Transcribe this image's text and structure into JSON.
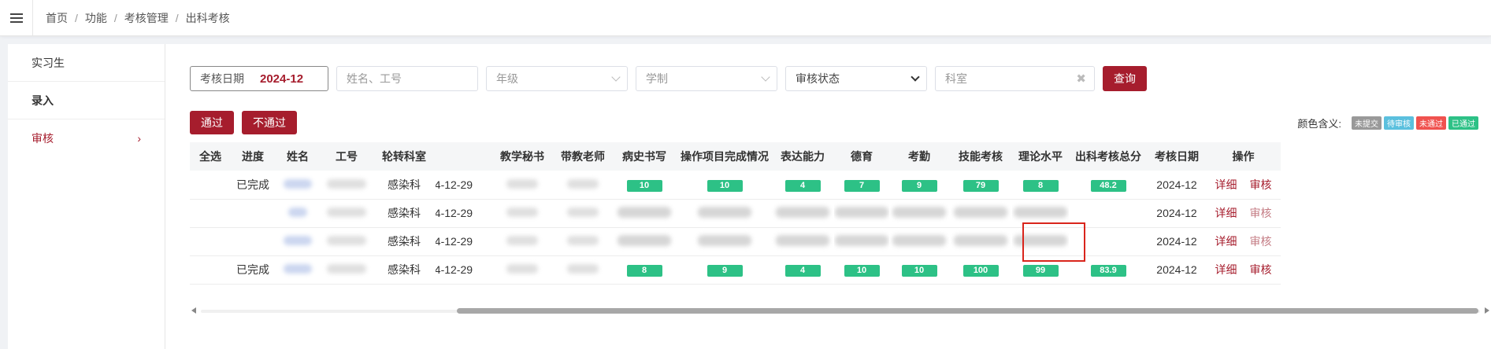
{
  "breadcrumb": [
    "首页",
    "功能",
    "考核管理",
    "出科考核"
  ],
  "sidebar": {
    "items": [
      {
        "label": "实习生"
      },
      {
        "label": "录入"
      },
      {
        "label": "审核"
      }
    ],
    "active_arrow": "›"
  },
  "filters": {
    "date_label": "考核日期",
    "date_value": "2024-12",
    "name_placeholder": "姓名、工号",
    "grade_placeholder": "年级",
    "system_placeholder": "学制",
    "status_selected": "审核状态",
    "dept_placeholder": "科室",
    "dept_clear": "✖",
    "search_label": "查询"
  },
  "actions": {
    "pass_label": "通过",
    "fail_label": "不通过"
  },
  "legend": {
    "label": "颜色含义:",
    "items": [
      {
        "text": "未提交",
        "color": "#999999"
      },
      {
        "text": "待审核",
        "color": "#5bc0de"
      },
      {
        "text": "未通过",
        "color": "#f0524f"
      },
      {
        "text": "已通过",
        "color": "#2dc186"
      }
    ]
  },
  "table": {
    "headers": [
      "全选",
      "进度",
      "姓名",
      "工号",
      "轮转科室",
      "",
      "教学秘书",
      "带教老师",
      "病史书写",
      "操作项目完成情况",
      "表达能力",
      "德育",
      "考勤",
      "技能考核",
      "理论水平",
      "出科考核总分",
      "考核日期",
      "操作"
    ],
    "rows": [
      {
        "progress": "已完成",
        "dept": "感染科",
        "date": "24-12-29",
        "scores": [
          "10",
          "10",
          "4",
          "7",
          "9",
          "79",
          "8"
        ],
        "total": "48.2",
        "exam_date": "2024-12",
        "detail": "详细",
        "review": "审核"
      },
      {
        "progress": "",
        "dept": "感染科",
        "date": "24-12-29",
        "scores": [],
        "total": "",
        "exam_date": "2024-12",
        "detail": "详细",
        "review": "审核"
      },
      {
        "progress": "",
        "dept": "感染科",
        "date": "24-12-29",
        "scores": [],
        "total": "",
        "exam_date": "2024-12",
        "detail": "详细",
        "review": "审核"
      },
      {
        "progress": "已完成",
        "dept": "感染科",
        "date": "24-12-29",
        "scores": [
          "8",
          "9",
          "4",
          "10",
          "10",
          "100",
          "99"
        ],
        "total": "83.9",
        "exam_date": "2024-12",
        "detail": "详细",
        "review": "审核"
      }
    ]
  },
  "colors": {
    "accent": "#a61d2d",
    "score_green": "#2dc186",
    "highlight_red": "#d9251c"
  }
}
